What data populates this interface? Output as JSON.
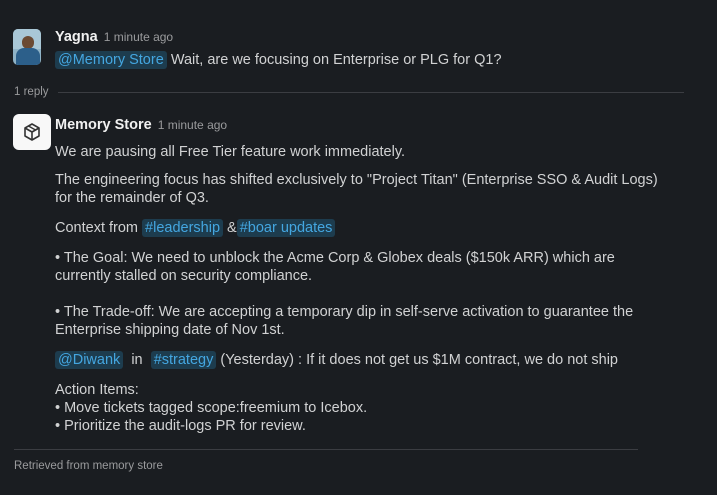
{
  "thread": {
    "question": {
      "author": "Yagna",
      "time": "1 minute ago",
      "mention": "@Memory Store",
      "text": "Wait, are we focusing on Enterprise or PLG for Q1?"
    },
    "reply_count": "1 reply",
    "answer": {
      "author": "Memory Store",
      "time": "1 minute ago",
      "line1": "We are pausing all Free Tier feature work immediately.",
      "line2": "The engineering focus has shifted exclusively to \"Project Titan\" (Enterprise SSO & Audit Logs)",
      "line3": "for the remainder of Q3.",
      "context_prefix": "Context from",
      "context_channel1": "#leadership",
      "context_amp": "&",
      "context_channel2": "#boar updates",
      "goal_line1": "• The Goal: We need to unblock the Acme Corp & Globex deals ($150k ARR) which are",
      "goal_line2": "currently stalled on security compliance.",
      "tradeoff_line1": "• The Trade-off: We are accepting a temporary dip in self-serve activation to guarantee the",
      "tradeoff_line2": "Enterprise shipping date of Nov 1st.",
      "quote_mention": "@Diwank",
      "quote_in": "in",
      "quote_channel": "#strategy",
      "quote_text": "(Yesterday) : If it does not get us $1M contract, we do not ship",
      "action_title": "Action Items:",
      "action_item1": "• Move tickets tagged scope:freemium to Icebox.",
      "action_item2": "• Prioritize the audit-logs PR for review."
    },
    "footer": "Retrieved from memory store"
  },
  "icons": {
    "user_avatar": "user-avatar",
    "bot_avatar": "cube-icon"
  },
  "colors": {
    "background": "#1a1d21",
    "mention_bg": "#1d3c4e",
    "mention_fg": "#44a6e0"
  }
}
